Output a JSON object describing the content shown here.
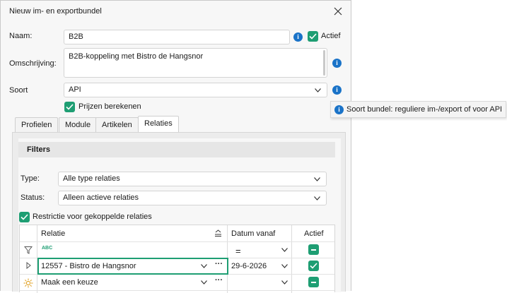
{
  "window": {
    "title": "Nieuw im- en exportbundel"
  },
  "form": {
    "naam_label": "Naam:",
    "naam_value": "B2B",
    "actief_label": "Actief",
    "omschrijving_label": "Omschrijving:",
    "omschrijving_value": "B2B-koppeling met Bistro de Hangsnor",
    "soort_label": "Soort",
    "soort_value": "API",
    "prijzen_label": "Prijzen berekenen"
  },
  "tooltip": {
    "text": "Soort bundel: reguliere im-/export of voor API"
  },
  "tabs": [
    {
      "label": "Profielen"
    },
    {
      "label": "Module"
    },
    {
      "label": "Artikelen"
    },
    {
      "label": "Relaties",
      "active": true
    }
  ],
  "filters": {
    "header": "Filters",
    "type_label": "Type:",
    "type_value": "Alle type relaties",
    "status_label": "Status:",
    "status_value": "Alleen actieve relaties",
    "restrictie_label": "Restrictie voor gekoppelde relaties"
  },
  "grid": {
    "columns": [
      "Relatie",
      "Datum vanaf",
      "Actief"
    ],
    "filter_row": {
      "relatie_glyph": "ABC",
      "datum_operator": "="
    },
    "rows": [
      {
        "relatie": "12557 - Bistro de Hangsnor",
        "datum": "29-6-2026",
        "actief": true
      },
      {
        "relatie": "Maak een keuze",
        "datum": "",
        "actief": false
      }
    ]
  },
  "colors": {
    "accent": "#1e9e73",
    "info": "#1a73c8"
  }
}
